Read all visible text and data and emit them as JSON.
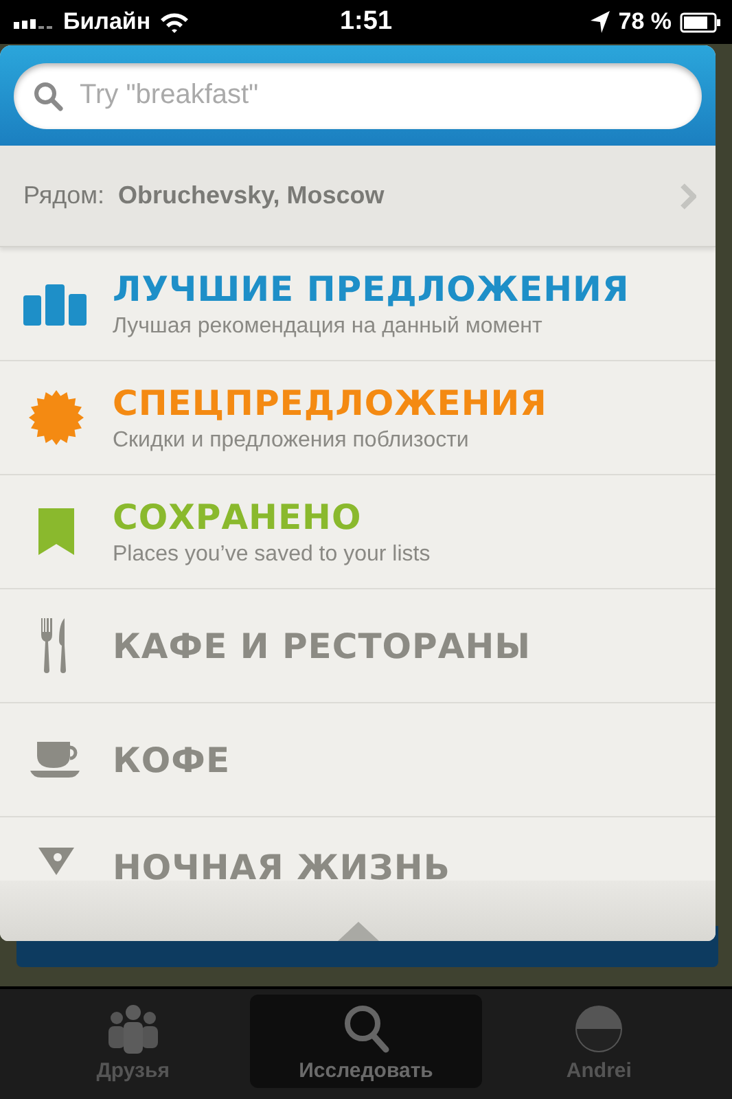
{
  "status_bar": {
    "carrier": "Билайн",
    "time": "1:51",
    "battery": "78 %"
  },
  "search": {
    "placeholder": "Try \"breakfast\""
  },
  "location": {
    "label": "Рядом:",
    "value": "Obruchevsky, Moscow"
  },
  "items": [
    {
      "kind": "featured",
      "title": "ЛУЧШИЕ ПРЕДЛОЖЕНИЯ",
      "subtitle": "Лучшая рекомендация на данный момент",
      "color": "#1e8fc8"
    },
    {
      "kind": "featured",
      "title": "СПЕЦПРЕДЛОЖЕНИЯ",
      "subtitle": "Скидки и предложения поблизости",
      "color": "#f48a12"
    },
    {
      "kind": "featured",
      "title": "СОХРАНЕНО",
      "subtitle": "Places you’ve saved to your lists",
      "color": "#8ab92d"
    },
    {
      "kind": "category",
      "title": "КАФЕ И РЕСТОРАНЫ"
    },
    {
      "kind": "category",
      "title": "КОФЕ"
    },
    {
      "kind": "category",
      "title": "НОЧНАЯ ЖИЗНЬ"
    }
  ],
  "tabs": [
    {
      "label": "Друзья",
      "selected": false
    },
    {
      "label": "Исследовать",
      "selected": true
    },
    {
      "label": "Andrei",
      "selected": false
    }
  ]
}
